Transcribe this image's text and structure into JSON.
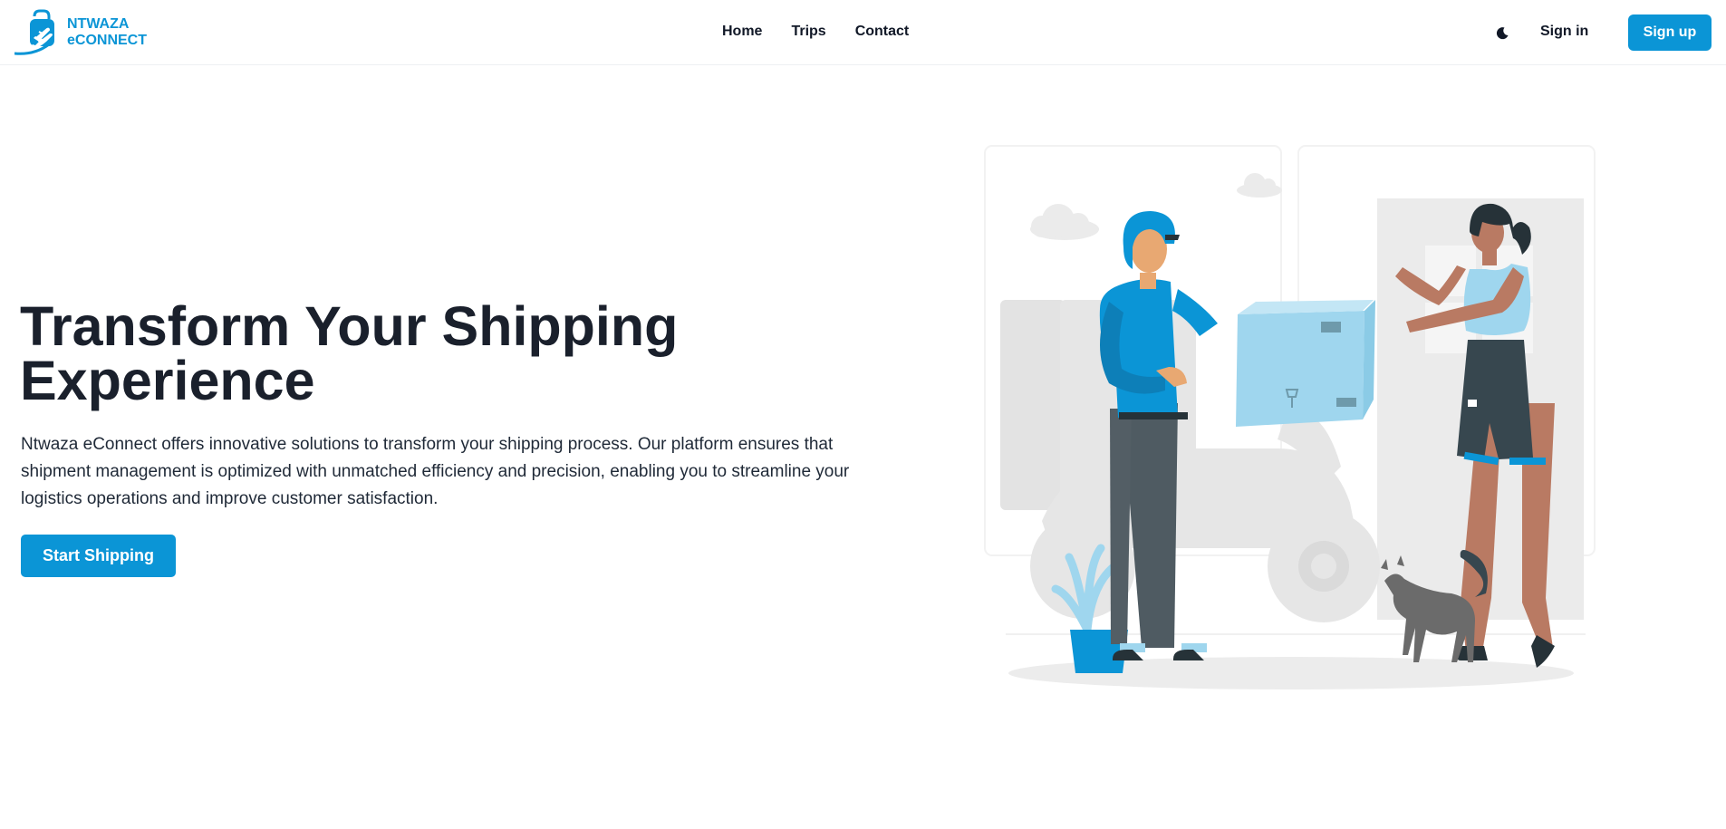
{
  "nav": {
    "brand_line1": "NTWAZA",
    "brand_line2": "eCONNECT",
    "links": [
      "Home",
      "Trips",
      "Contact"
    ],
    "theme_icon": "moon-icon",
    "signin_label": "Sign in",
    "signup_label": "Sign up"
  },
  "hero": {
    "title": "Transform Your Shipping Experience",
    "description": "Ntwaza eConnect offers innovative solutions to transform your shipping process. Our platform ensures that shipment management is optimized with unmatched efficiency and precision, enabling you to streamline your logistics operations and improve customer satisfaction.",
    "cta_label": "Start Shipping",
    "illustration": "delivery-illustration"
  },
  "colors": {
    "accent": "#0b95d6",
    "heading": "#1a202c",
    "body_text": "#1f2937",
    "illustration_light_blue": "#9fd6ee",
    "illustration_grey": "#ebebeb"
  }
}
